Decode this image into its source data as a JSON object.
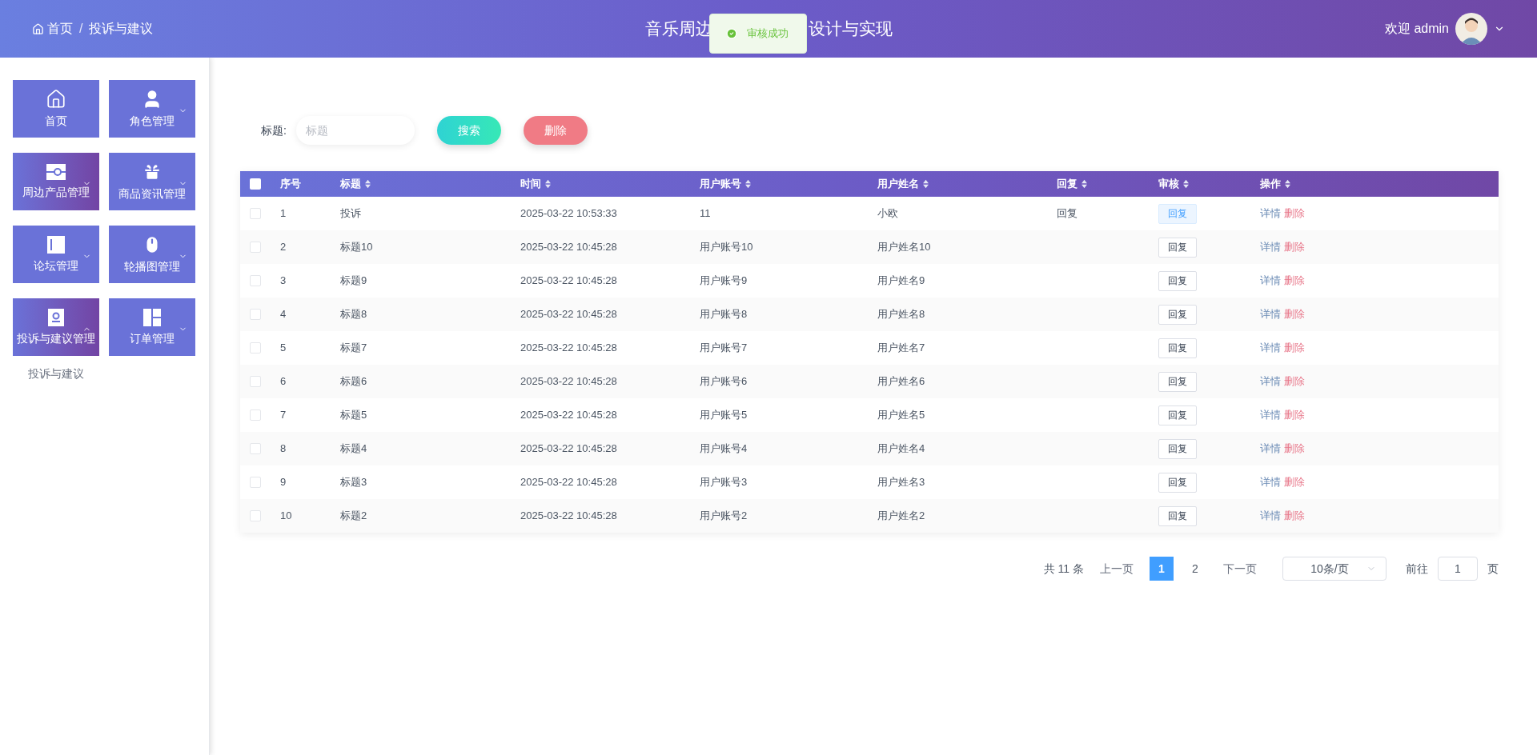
{
  "header": {
    "breadcrumb": [
      {
        "label": "首页"
      },
      {
        "label": "投诉与建议"
      }
    ],
    "breadcrumb_separator": "/",
    "title_start": "音乐周边",
    "title_end": "设计与实现",
    "toast": "审核成功",
    "welcome": "欢迎 admin"
  },
  "sidebar": {
    "items": [
      {
        "label": "首页",
        "kind": "link",
        "highlighted": false
      },
      {
        "label": "角色管理",
        "kind": "menu",
        "expanded": false,
        "highlighted": false
      },
      {
        "label": "周边产品管理",
        "kind": "menu",
        "expanded": false,
        "highlighted": true
      },
      {
        "label": "商品资讯管理",
        "kind": "menu",
        "expanded": false,
        "highlighted": false
      },
      {
        "label": "论坛管理",
        "kind": "menu",
        "expanded": false,
        "highlighted": false
      },
      {
        "label": "轮播图管理",
        "kind": "menu",
        "expanded": false,
        "highlighted": false
      },
      {
        "label": "投诉与建议管理",
        "kind": "menu",
        "expanded": true,
        "highlighted": true,
        "children": [
          {
            "label": "投诉与建议"
          }
        ]
      },
      {
        "label": "订单管理",
        "kind": "menu",
        "expanded": false,
        "highlighted": false
      }
    ]
  },
  "search": {
    "label": "标题:",
    "placeholder": "标题",
    "buttons": [
      {
        "label": "搜索",
        "kind": "search"
      },
      {
        "label": "删除",
        "kind": "delete"
      }
    ]
  },
  "table": {
    "select_all": {
      "checked": false
    },
    "columns": [
      {
        "label": "序号",
        "sortable": false
      },
      {
        "label": "标题",
        "sortable": true
      },
      {
        "label": "时间",
        "sortable": true
      },
      {
        "label": "用户账号",
        "sortable": true
      },
      {
        "label": "用户姓名",
        "sortable": true
      },
      {
        "label": "回复",
        "sortable": true
      },
      {
        "label": "审核",
        "sortable": true
      },
      {
        "label": "操作",
        "sortable": true
      }
    ],
    "rows": [
      {
        "checked": false,
        "index": "1",
        "title": "投诉",
        "time": "2025-03-22 10:53:33",
        "account": "11",
        "name": "小欧",
        "reply": "回复",
        "review": "回复",
        "review_active": true,
        "actions": [
          "详情",
          "删除"
        ]
      },
      {
        "checked": false,
        "index": "2",
        "title": "标题10",
        "time": "2025-03-22 10:45:28",
        "account": "用户账号10",
        "name": "用户姓名10",
        "review": "回复",
        "review_active": false,
        "actions": [
          "详情",
          "删除"
        ]
      },
      {
        "checked": false,
        "index": "3",
        "title": "标题9",
        "time": "2025-03-22 10:45:28",
        "account": "用户账号9",
        "name": "用户姓名9",
        "review": "回复",
        "review_active": false,
        "actions": [
          "详情",
          "删除"
        ]
      },
      {
        "checked": false,
        "index": "4",
        "title": "标题8",
        "time": "2025-03-22 10:45:28",
        "account": "用户账号8",
        "name": "用户姓名8",
        "review": "回复",
        "review_active": false,
        "actions": [
          "详情",
          "删除"
        ]
      },
      {
        "checked": false,
        "index": "5",
        "title": "标题7",
        "time": "2025-03-22 10:45:28",
        "account": "用户账号7",
        "name": "用户姓名7",
        "review": "回复",
        "review_active": false,
        "actions": [
          "详情",
          "删除"
        ]
      },
      {
        "checked": false,
        "index": "6",
        "title": "标题6",
        "time": "2025-03-22 10:45:28",
        "account": "用户账号6",
        "name": "用户姓名6",
        "review": "回复",
        "review_active": false,
        "actions": [
          "详情",
          "删除"
        ]
      },
      {
        "checked": false,
        "index": "7",
        "title": "标题5",
        "time": "2025-03-22 10:45:28",
        "account": "用户账号5",
        "name": "用户姓名5",
        "review": "回复",
        "review_active": false,
        "actions": [
          "详情",
          "删除"
        ]
      },
      {
        "checked": false,
        "index": "8",
        "title": "标题4",
        "time": "2025-03-22 10:45:28",
        "account": "用户账号4",
        "name": "用户姓名4",
        "review": "回复",
        "review_active": false,
        "actions": [
          "详情",
          "删除"
        ]
      },
      {
        "checked": false,
        "index": "9",
        "title": "标题3",
        "time": "2025-03-22 10:45:28",
        "account": "用户账号3",
        "name": "用户姓名3",
        "review": "回复",
        "review_active": false,
        "actions": [
          "详情",
          "删除"
        ]
      },
      {
        "checked": false,
        "index": "10",
        "title": "标题2",
        "time": "2025-03-22 10:45:28",
        "account": "用户账号2",
        "name": "用户姓名2",
        "review": "回复",
        "review_active": false,
        "actions": [
          "详情",
          "删除"
        ]
      }
    ]
  },
  "pagination": {
    "total": "共 11 条",
    "prev": "上一页",
    "pages": [
      {
        "label": "1",
        "selected": true
      },
      {
        "label": "2",
        "selected": false
      }
    ],
    "next": "下一页",
    "page_size": "10条/页",
    "goto_label": "前往",
    "goto_value": "1",
    "goto_suffix": "页"
  }
}
